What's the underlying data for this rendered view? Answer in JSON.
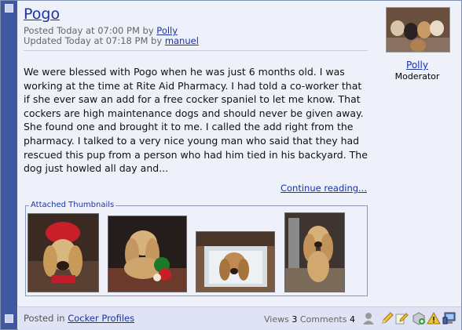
{
  "post": {
    "title": "Pogo",
    "posted_prefix": "Posted Today at 07:00 PM by",
    "posted_author": "Polly",
    "updated_prefix": "Updated Today at 07:18 PM by",
    "updated_author": "manuel",
    "body": "We were blessed with Pogo when he was just 6 months old. I was working at the time at Rite Aid Pharmacy. I had told a co-worker that if she ever saw an add for a free cocker spaniel to let me know. That cockers are high maintenance dogs and should never be given away. She found one and brought it to me. I called the add right from the pharmacy. I talked to a very nice young man who said that they had rescued this pup from a person who had him tied in his backyard. The dog just howled all day and...",
    "continue_label": "Continue reading..."
  },
  "attachments": {
    "legend": "Attached Thumbnails",
    "thumbnails": [
      {
        "name": "cocker-red-hat"
      },
      {
        "name": "cocker-with-toy"
      },
      {
        "name": "cocker-in-basket"
      },
      {
        "name": "cocker-standing"
      }
    ]
  },
  "author": {
    "name": "Polly",
    "role": "Moderator"
  },
  "footer": {
    "posted_in_prefix": "Posted in",
    "category": "Cocker Profiles",
    "views_label": "Views",
    "views_count": "3",
    "comments_label": "Comments",
    "comments_count": "4",
    "icons": [
      "user-icon",
      "pencil-edit-icon",
      "edit-note-icon",
      "add-comment-icon",
      "warning-icon",
      "computer-icon"
    ]
  },
  "colors": {
    "link": "#1a33a8",
    "sidebar": "#3f58a0",
    "panel": "#eef0fa",
    "footer": "#dfe3f3"
  }
}
